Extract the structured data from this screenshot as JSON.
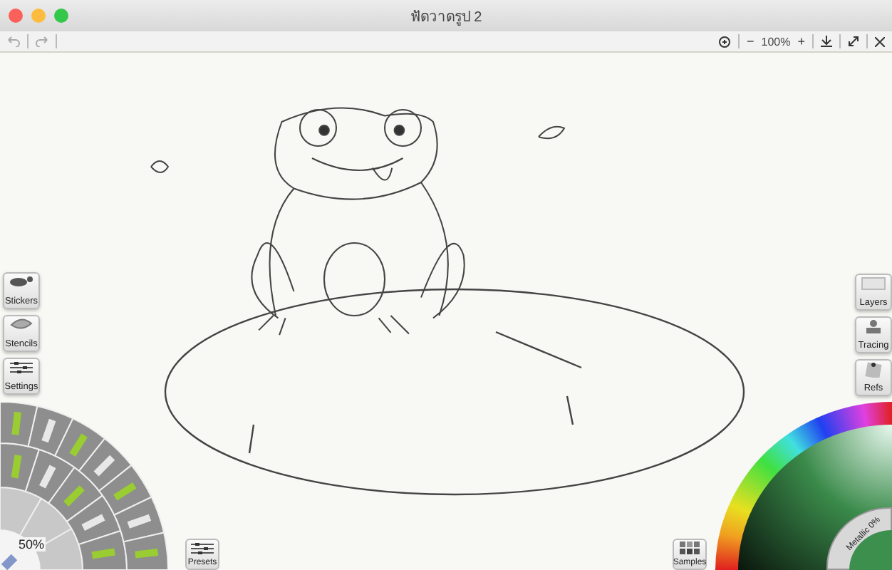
{
  "window": {
    "title": "ฟัดวาดรูป 2"
  },
  "toolbar": {
    "zoom_out": "−",
    "zoom": "100%",
    "zoom_in": "+"
  },
  "left_panels": [
    {
      "label": "Stickers",
      "kind": "stickers"
    },
    {
      "label": "Stencils",
      "kind": "stencils"
    },
    {
      "label": "Settings",
      "kind": "settings"
    }
  ],
  "right_panels": [
    {
      "label": "Layers",
      "kind": "layers"
    },
    {
      "label": "Tracing",
      "kind": "tracing"
    },
    {
      "label": "Refs",
      "kind": "refs"
    }
  ],
  "tool_picker": {
    "size": "50%",
    "presets": "Presets"
  },
  "color_picker": {
    "metallic": "Metallic 0%",
    "samples": "Samples"
  }
}
